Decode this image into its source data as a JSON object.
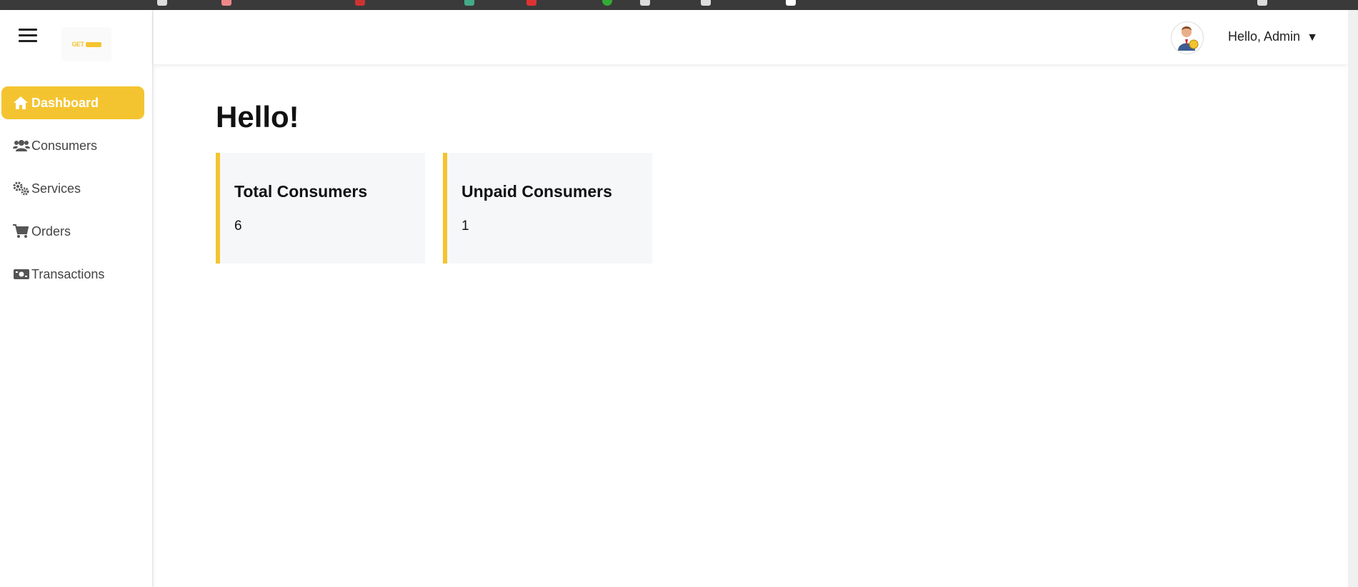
{
  "brand": {
    "logo_text": "GET",
    "accent_color": "#f4c430"
  },
  "sidebar": {
    "items": [
      {
        "label": "Dashboard",
        "icon": "home-icon",
        "active": true
      },
      {
        "label": "Consumers",
        "icon": "users-icon",
        "active": false
      },
      {
        "label": "Services",
        "icon": "gears-icon",
        "active": false
      },
      {
        "label": "Orders",
        "icon": "cart-icon",
        "active": false
      },
      {
        "label": "Transactions",
        "icon": "money-bill-icon",
        "active": false
      }
    ]
  },
  "header": {
    "greeting": "Hello, Admin",
    "dropdown_caret": "▼",
    "avatar_icon": "user-avatar-icon"
  },
  "main": {
    "title": "Hello!",
    "cards": [
      {
        "title": "Total Consumers",
        "value": "6"
      },
      {
        "title": "Unpaid Consumers",
        "value": "1"
      }
    ]
  }
}
